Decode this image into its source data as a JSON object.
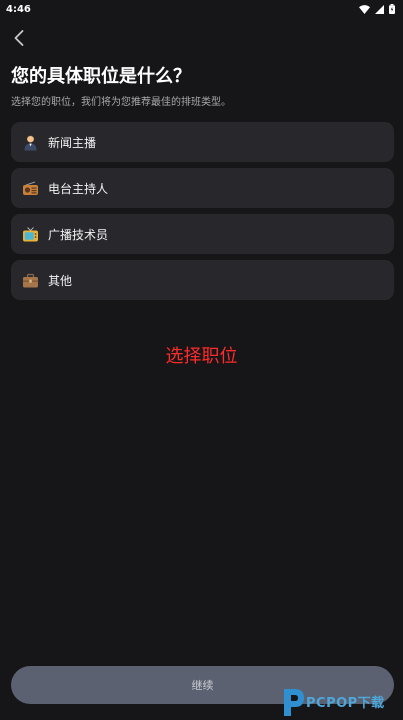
{
  "status_bar": {
    "time": "4:46"
  },
  "header": {
    "back_icon": "chevron-left-icon",
    "title": "您的具体职位是什么？",
    "subtitle": "选择您的职位，我们将为您推荐最佳的排班类型。"
  },
  "options": [
    {
      "icon": "person-icon",
      "label": "新闻主播"
    },
    {
      "icon": "radio-icon",
      "label": "电台主持人"
    },
    {
      "icon": "tv-icon",
      "label": "广播技术员"
    },
    {
      "icon": "briefcase-icon",
      "label": "其他"
    }
  ],
  "overlay_caption": "选择职位",
  "footer": {
    "continue_label": "继续"
  },
  "watermark": {
    "text": "PCPOP下载"
  },
  "colors": {
    "background": "#161618",
    "card": "#28282c",
    "button": "#5c6171",
    "caption": "#ff2a2a"
  }
}
